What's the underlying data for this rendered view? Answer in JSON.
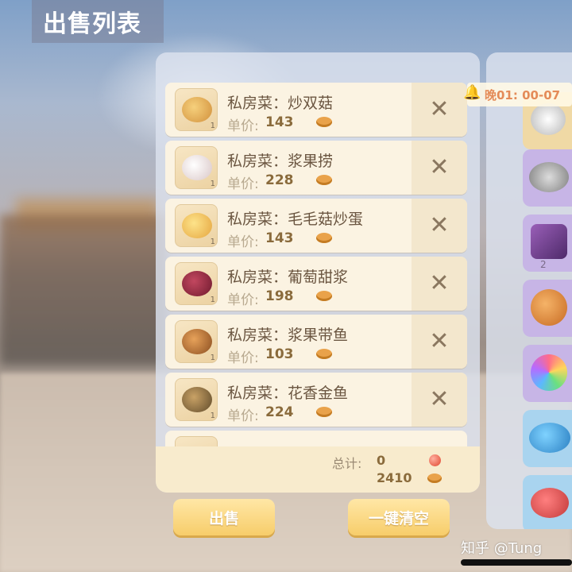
{
  "header": {
    "title": "出售列表"
  },
  "items": [
    {
      "name": "私房菜：炒双菇",
      "price_label": "单价:",
      "price": "143",
      "qty": "1",
      "icon": "dish-mushroom-icon",
      "color": "#e2a94f"
    },
    {
      "name": "私房菜：浆果捞",
      "price_label": "单价:",
      "price": "228",
      "qty": "1",
      "icon": "dish-berry-bowl-icon",
      "color": "#e9d6d6"
    },
    {
      "name": "私房菜：毛毛菇炒蛋",
      "price_label": "单价:",
      "price": "143",
      "qty": "1",
      "icon": "dish-egg-icon",
      "color": "#f1c155"
    },
    {
      "name": "私房菜：葡萄甜浆",
      "price_label": "单价:",
      "price": "198",
      "qty": "1",
      "icon": "dish-grape-drink-icon",
      "color": "#9a2a44"
    },
    {
      "name": "私房菜：浆果带鱼",
      "price_label": "单价:",
      "price": "103",
      "qty": "1",
      "icon": "dish-fish-icon",
      "color": "#c7722f"
    },
    {
      "name": "私房菜：花香金鱼",
      "price_label": "单价:",
      "price": "224",
      "qty": "1",
      "icon": "dish-wrapped-fish-icon",
      "color": "#8a6a3a"
    }
  ],
  "footer": {
    "total_label": "总计:",
    "total_gem": "0",
    "total_coin": "2410"
  },
  "buttons": {
    "sell": "出售",
    "clear_all": "一键清空"
  },
  "notice": {
    "text": "晚01: 00-07"
  },
  "right_panel": {
    "cells": [
      {
        "icon": "shell-item-icon",
        "color": "#f0d9a5"
      },
      {
        "icon": "grey-fish-item-icon",
        "color": "#c7b5e6"
      },
      {
        "icon": "purple-gift-item-icon",
        "color": "#c7b5e6",
        "count": "2"
      },
      {
        "icon": "orange-duck-item-icon",
        "color": "#c7b5e6"
      },
      {
        "icon": "pinwheel-item-icon",
        "color": "#c7b5e6"
      },
      {
        "icon": "blue-fish-item-icon",
        "color": "#a9d4ef"
      },
      {
        "icon": "red-fish-item-icon",
        "color": "#a9d4ef"
      }
    ]
  },
  "watermark": "知乎 @Tung"
}
